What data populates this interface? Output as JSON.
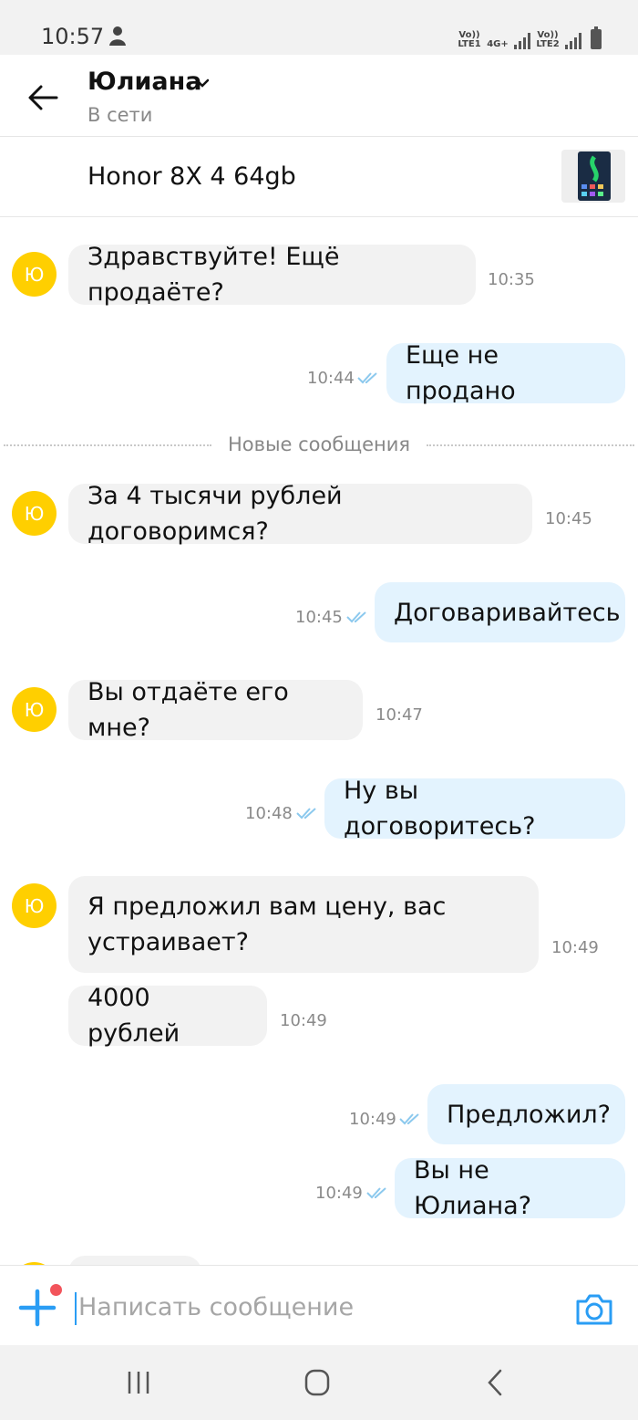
{
  "status_bar": {
    "time": "10:57",
    "sim1": "Vo)) LTE1",
    "network_type": "4G+",
    "sim2": "Vo)) LTE2"
  },
  "header": {
    "contact_name": "Юлиана",
    "contact_status": "В сети"
  },
  "listing": {
    "title": "Honor 8X 4 64gb"
  },
  "avatar_initial": "Ю",
  "messages": [
    {
      "from": "them",
      "text": "Здравствуйте! Ещё продаёте?",
      "time": "10:35"
    },
    {
      "from": "me",
      "text": "Еще не продано",
      "time": "10:44",
      "read": true
    },
    {
      "from": "them",
      "text": "За 4 тысячи рублей договоримся?",
      "time": "10:45"
    },
    {
      "from": "me",
      "text": "Договаривайтесь",
      "time": "10:45",
      "read": true
    },
    {
      "from": "them",
      "text": "Вы отдаёте его мне?",
      "time": "10:47"
    },
    {
      "from": "me",
      "text": "Ну вы договоритесь?",
      "time": "10:48",
      "read": true
    },
    {
      "from": "them",
      "text_line1": "Я предложил вам цену,  вас",
      "text_line2": "устраивает?",
      "time": "10:49"
    },
    {
      "from": "them",
      "text": "4000 рублей",
      "time": "10:49"
    },
    {
      "from": "me",
      "text": "Предложил?",
      "time": "10:49",
      "read": true
    },
    {
      "from": "me",
      "text": "Вы не Юлиана?",
      "time": "10:49",
      "read": true
    }
  ],
  "divider": {
    "label": "Новые сообщения"
  },
  "composer": {
    "placeholder": "Написать сообщение"
  },
  "colors": {
    "avatar": "#ffcf00",
    "incoming_bubble": "#f2f2f2",
    "outgoing_bubble": "#e3f3fe",
    "accent": "#2a9df4",
    "notification_dot": "#f2545b",
    "read_ticks": "#8cc9ee"
  }
}
